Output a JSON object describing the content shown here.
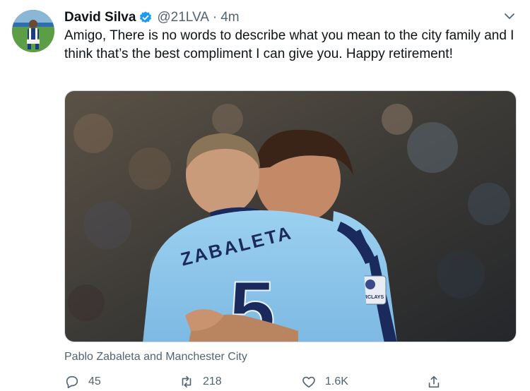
{
  "tweet": {
    "author_name": "David Silva",
    "handle": "@21LVA",
    "separator": "·",
    "time": "4m",
    "text": "Amigo, There is no words to describe what you mean to the city family and I think that’s the best compliment I can give you. Happy retirement!",
    "media_caption": "Pablo Zabaleta and Manchester City",
    "jersey_name": "ZABALETA",
    "jersey_number": "5",
    "sleeve_badge": "BARCLAYS"
  },
  "actions": {
    "reply_count": "45",
    "retweet_count": "218",
    "like_count": "1.6K"
  },
  "colors": {
    "verified_blue": "#1d9bf0",
    "secondary_text": "#536471",
    "jersey_sky_blue": "#8ec5ea",
    "jersey_navy": "#1b2a5c"
  },
  "icons": [
    "verified-badge-icon",
    "chevron-down-icon",
    "reply-icon",
    "retweet-icon",
    "like-icon",
    "share-icon"
  ]
}
